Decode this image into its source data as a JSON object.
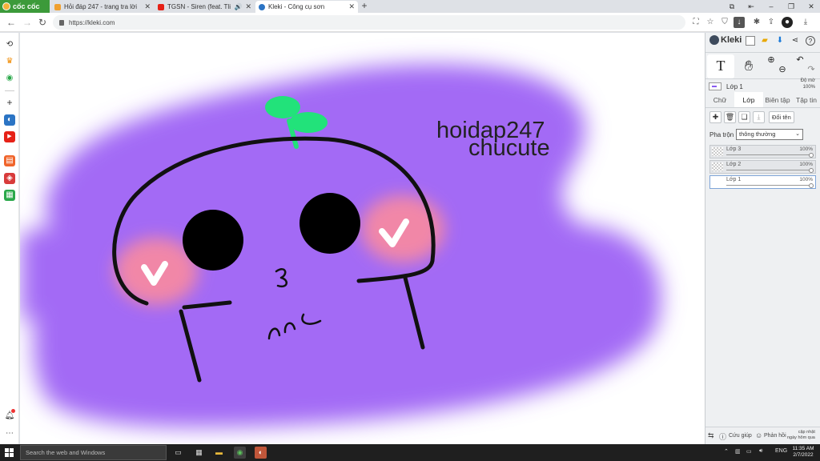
{
  "browser": {
    "brand": "cốc cốc",
    "tabs": [
      {
        "title": "Hỏi đáp 247 - trang tra lời",
        "favicon_color": "#f0a030"
      },
      {
        "title": "TGSN - Siren (feat. Tlinh",
        "favicon_color": "#e62117"
      },
      {
        "title": "Kleki - Công cụ sơn",
        "favicon_color": "#2b74c4"
      }
    ],
    "url": "https://kleki.com"
  },
  "canvas": {
    "text_line1": "hoidap247",
    "text_line2": "chucute",
    "colors": {
      "purple": "#a36bf5",
      "leaf": "#22e27a",
      "blush": "#ff8c9a",
      "ink": "#111111"
    }
  },
  "kleki": {
    "logo": "Kleki",
    "current_layer": "Lớp 1",
    "opacity_line1": "Độ mờ",
    "opacity_line2": "100%",
    "tabs": [
      "Chữ",
      "Lớp",
      "Biên tập",
      "Tập tin"
    ],
    "active_tab": "Lớp",
    "rename_label": "Đổi tên",
    "blend_label": "Pha trộn",
    "blend_value": "thông thường",
    "layers": [
      {
        "name": "Lớp 3",
        "opacity": "100%"
      },
      {
        "name": "Lớp 2",
        "opacity": "100%"
      },
      {
        "name": "Lớp 1",
        "opacity": "100%"
      }
    ],
    "footer": {
      "help": "Cứu giúp",
      "feedback": "Phản hồi",
      "updated_line1": "cập nhật",
      "updated_line2": "ngày hôm qua"
    }
  },
  "taskbar": {
    "search_placeholder": "Search the web and Windows",
    "language": "ENG",
    "time": "11:35 AM",
    "date": "2/7/2022"
  }
}
